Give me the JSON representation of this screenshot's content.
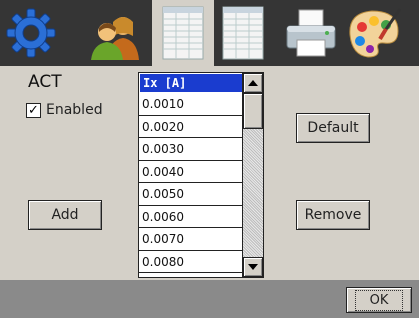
{
  "toolbar": {
    "tools": [
      {
        "icon": "gear-icon"
      },
      {
        "icon": "users-icon"
      },
      {
        "icon": "table-icon"
      },
      {
        "icon": "table-icon"
      },
      {
        "icon": "printer-icon"
      },
      {
        "icon": "palette-icon"
      }
    ],
    "active_tool": 2
  },
  "panel": {
    "title": "ACT",
    "enabled": {
      "label": "Enabled",
      "checked": true
    },
    "buttons": {
      "add": "Add",
      "default": "Default",
      "remove": "Remove"
    },
    "list": {
      "header": "Ix [A]",
      "items": [
        "0.0010",
        "0.0020",
        "0.0030",
        "0.0040",
        "0.0050",
        "0.0060",
        "0.0070",
        "0.0080"
      ]
    }
  },
  "footer": {
    "ok": "OK"
  },
  "colors": {
    "toolbar_bg": "#353535",
    "panel_bg": "#d4d0c8",
    "footer_bg": "#8a8a8a",
    "list_header_bg": "#1a3ccf"
  }
}
